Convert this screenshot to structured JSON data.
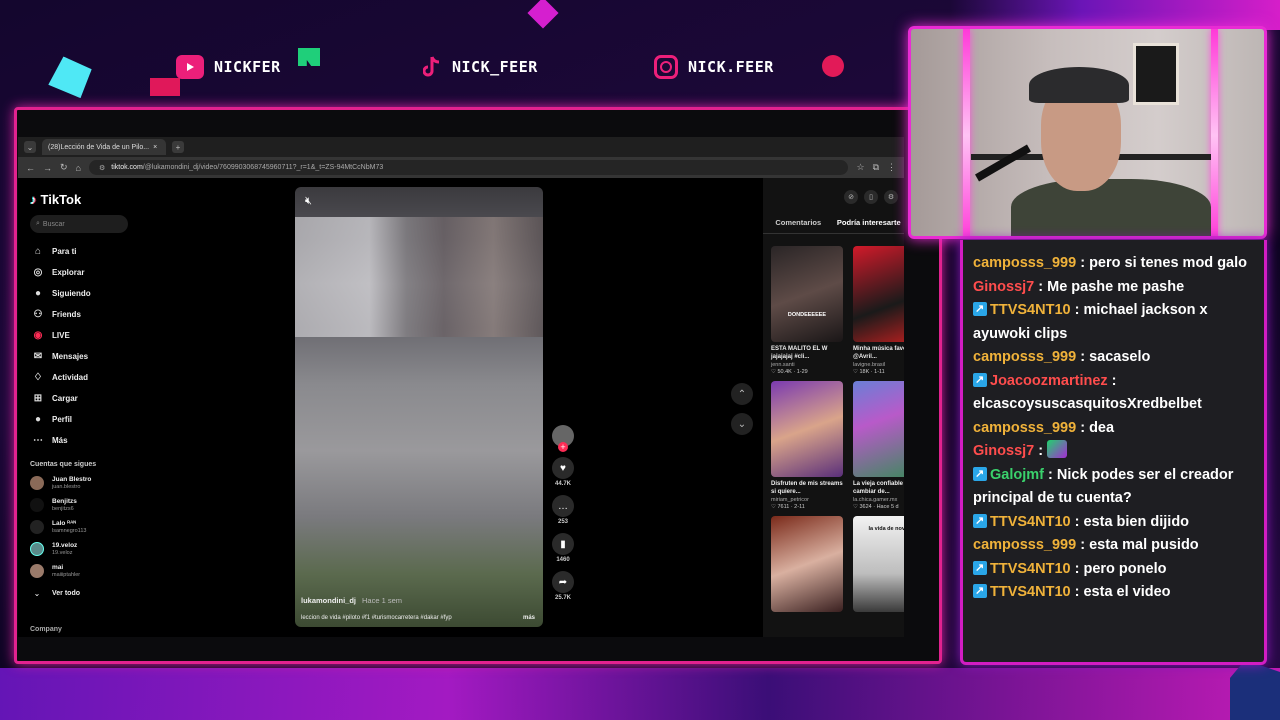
{
  "colors": {
    "accent": "#e2228f",
    "chat_frame": "#d21dc3",
    "user_yellow": "#f0b23a",
    "user_red": "#ff4d4d",
    "user_green": "#3ad16c"
  },
  "socials": [
    {
      "icon": "youtube-icon",
      "handle": "NICKFER"
    },
    {
      "icon": "tiktok-icon",
      "handle": "NICK_FEER"
    },
    {
      "icon": "instagram-icon",
      "handle": "NICK.FEER"
    }
  ],
  "browser": {
    "tab_title": "(28)Lección de Vida de un Pilo...",
    "url_host": "tiktok.com",
    "url_path": "/@lukamondini_dj/video/7609903068745960711?_r=1&_t=ZS-94MtCcNbM73"
  },
  "tiktok": {
    "logo": "TikTok",
    "search_placeholder": "Buscar",
    "menu": [
      {
        "label": "Para ti",
        "icon": "home-icon"
      },
      {
        "label": "Explorar",
        "icon": "compass-icon"
      },
      {
        "label": "Siguiendo",
        "icon": "following-icon"
      },
      {
        "label": "Friends",
        "icon": "friends-icon"
      },
      {
        "label": "LIVE",
        "icon": "live-icon"
      },
      {
        "label": "Mensajes",
        "icon": "message-icon"
      },
      {
        "label": "Actividad",
        "icon": "activity-icon"
      },
      {
        "label": "Cargar",
        "icon": "upload-icon"
      },
      {
        "label": "Perfil",
        "icon": "profile-icon"
      },
      {
        "label": "Más",
        "icon": "more-icon"
      }
    ],
    "following_heading": "Cuentas que sigues",
    "following": [
      {
        "name": "Juan Blestro",
        "handle": "juan.blestro"
      },
      {
        "name": "Benjitzs",
        "handle": "benjitzs6"
      },
      {
        "name": "Lalo ᴿᴬᴺ",
        "handle": "lsamnegro113"
      },
      {
        "name": "19.veloz",
        "handle": "19.veloz"
      },
      {
        "name": "mai",
        "handle": "maiiiptahler"
      }
    ],
    "see_all": "Ver todo",
    "company": "Company",
    "video": {
      "username": "lukamondini_dj",
      "age": "Hace 1 sem",
      "caption": "leccion de vida #piloto #f1 #turismocarretera #dakar #fyp",
      "more": "más"
    },
    "actions": [
      {
        "icon": "heart-icon",
        "count": "44.7K"
      },
      {
        "icon": "comment-icon",
        "count": "253"
      },
      {
        "icon": "bookmark-icon",
        "count": "1460"
      },
      {
        "icon": "share-icon",
        "count": "25.7K"
      }
    ],
    "right_tabs": [
      "Comentarios",
      "Podría interesarte"
    ],
    "cards": [
      {
        "overlay": "DONDEEEEEE",
        "title": "ESTA MALITO EL W jajajajaj #cli...",
        "author": "jenn.santi",
        "stats": "♡ 50.4K · 1-29",
        "bg": "linear-gradient(160deg,#2a2526,#5e4b47 50%,#1a1617)"
      },
      {
        "overlay": "",
        "title": "Minha música favorita @Avril...",
        "author": "lavigne.brasil",
        "stats": "♡ 18K · 1-11",
        "bg": "linear-gradient(160deg,#d21a2a,#1a1a1a 60%,#c02020)"
      },
      {
        "overlay": "",
        "title": "Disfruten de mis streams si quiere...",
        "author": "miriam_petricor",
        "stats": "♡ 7611 · 2-11",
        "bg": "linear-gradient(160deg,#7a3ab0,#d9a48a 50%,#5a2f7a)"
      },
      {
        "overlay": "",
        "title": "La vieja confiable jajaja cambiar de...",
        "author": "la.chica.gamer.mx",
        "stats": "♡ 3624 · Hace 5 d",
        "bg": "linear-gradient(160deg,#6a7fd6,#b85ac9 40%,#3a8a5a)"
      },
      {
        "overlay": "",
        "title": "",
        "author": "",
        "stats": "",
        "bg": "linear-gradient(160deg,#7a2a1a,#d9b0a0 50%,#3a2020)"
      },
      {
        "overlay": "la vida de novia",
        "title": "",
        "author": "",
        "stats": "",
        "bg": "linear-gradient(180deg,#f2f2f2,#bdbdbd 60%,#3a3a3a)"
      }
    ]
  },
  "chat": [
    {
      "user": "camposss_999",
      "color": "y",
      "badge": false,
      "text": "pero si tenes mod galo"
    },
    {
      "user": "Ginossj7",
      "color": "r",
      "badge": false,
      "text": "Me pashe me pashe"
    },
    {
      "user": "TTVS4NT10",
      "color": "y",
      "badge": true,
      "text": "michael jackson x ayuwoki clips"
    },
    {
      "user": "camposss_999",
      "color": "y",
      "badge": false,
      "text": "sacaselo"
    },
    {
      "user": "Joacoozmartinez",
      "color": "r",
      "badge": true,
      "text": "elcascoysuscasquitosXredbelbet"
    },
    {
      "user": "camposss_999",
      "color": "y",
      "badge": false,
      "text": "dea"
    },
    {
      "user": "Ginossj7",
      "color": "r",
      "badge": false,
      "text": "",
      "emote": true
    },
    {
      "user": "Galojmf",
      "color": "g",
      "badge": true,
      "text": "Nick podes ser el creador principal de tu cuenta?"
    },
    {
      "user": "TTVS4NT10",
      "color": "y",
      "badge": true,
      "text": "esta bien dijido"
    },
    {
      "user": "camposss_999",
      "color": "y",
      "badge": false,
      "text": "esta mal pusido"
    },
    {
      "user": "TTVS4NT10",
      "color": "y",
      "badge": true,
      "text": "pero ponelo"
    },
    {
      "user": "TTVS4NT10",
      "color": "y",
      "badge": true,
      "text": "esta el video"
    }
  ]
}
